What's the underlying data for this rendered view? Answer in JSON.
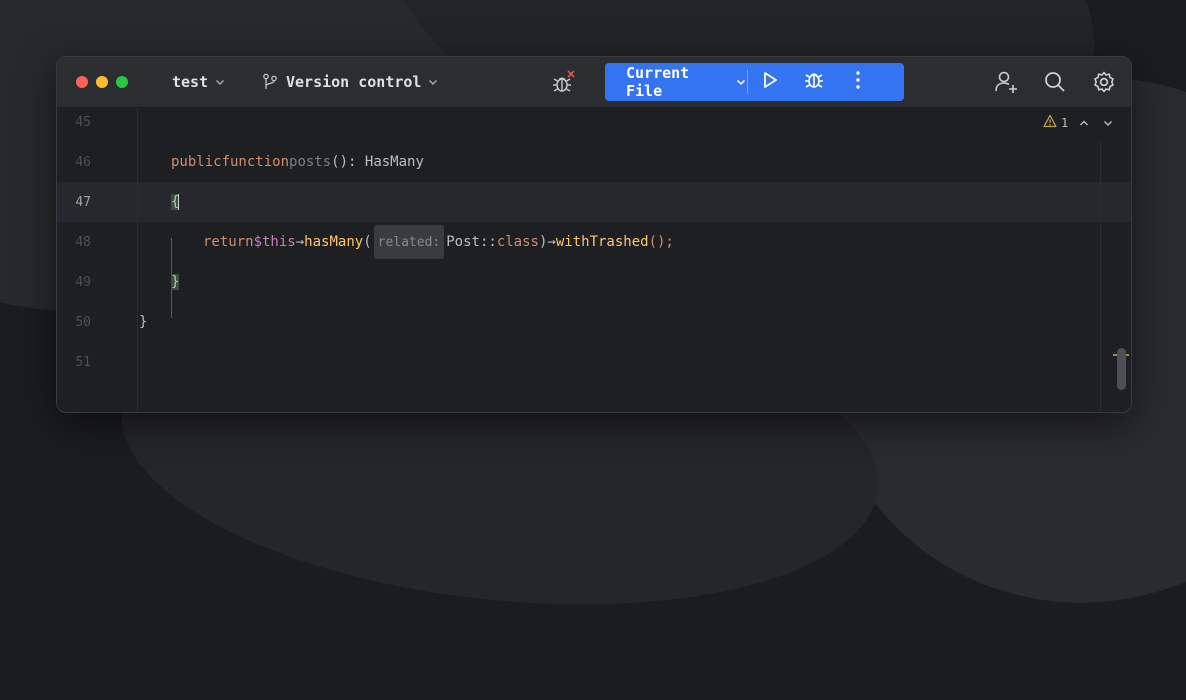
{
  "titlebar": {
    "project_name": "test",
    "vcs_label": "Version control",
    "run_config": "Current File"
  },
  "icons": {
    "project_chevron": "chevron-down-icon",
    "vcs": "branch-icon",
    "debug_status": "bug-error-icon",
    "run": "play-icon",
    "debug": "bug-icon",
    "more": "more-vertical-icon",
    "user": "add-user-icon",
    "search": "search-icon",
    "settings": "gear-icon"
  },
  "inspection": {
    "warning_count": "1"
  },
  "editor": {
    "lines": [
      {
        "number": "45"
      },
      {
        "number": "46",
        "kw1": "public",
        "kw2": "function",
        "name": "posts",
        "rest": "(): HasMany"
      },
      {
        "number": "47",
        "open_brace": "{"
      },
      {
        "number": "48",
        "kw": "return",
        "var": "$this",
        "arrow1": "→",
        "method": "hasMany",
        "paren": "(",
        "hint": "related:",
        "cls": "Post",
        "sep": "::",
        "classkw": "class",
        "close": ")",
        "arrow2": "→",
        "method2": "withTrashed",
        "end": "();"
      },
      {
        "number": "49",
        "close_brace": "}"
      },
      {
        "number": "50",
        "brace": "}"
      },
      {
        "number": "51"
      }
    ]
  },
  "colors": {
    "accent": "#3574f0",
    "keyword": "#cf8e6d",
    "method_call": "#ffc66d",
    "variable": "#c77dbb",
    "brace_highlight": "#375239"
  }
}
